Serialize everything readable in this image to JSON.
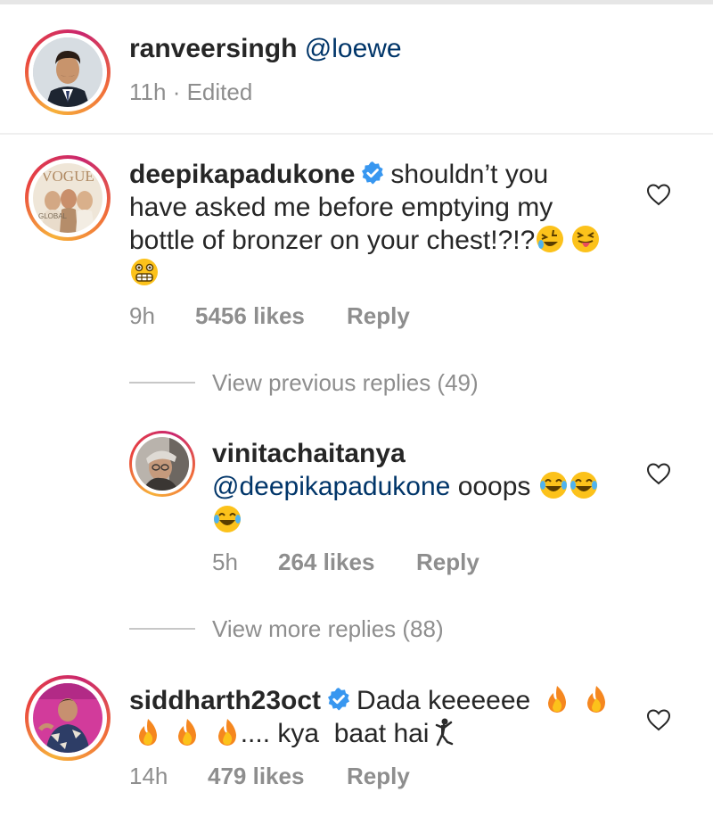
{
  "post": {
    "username": "ranveersingh",
    "mention": "@loewe",
    "time": "11h",
    "separator": "·",
    "edited": "Edited"
  },
  "comments": [
    {
      "username": "deepikapadukone",
      "verified": true,
      "line1": "shouldn’t you",
      "line2": "have asked me before emptying my",
      "line3": "bottle of bronzer on your chest!?!?",
      "time": "9h",
      "likes": "5456 likes",
      "reply": "Reply",
      "avatar_text": "VOGUE",
      "avatar_caption": "GLOBAL"
    },
    {
      "username": "vinitachaitanya",
      "mention": "@deepikapadukone",
      "text": "ooops",
      "time": "5h",
      "likes": "264 likes",
      "reply": "Reply"
    },
    {
      "username": "siddharth23oct",
      "verified": true,
      "line1": "Dada keeeeee",
      "line2": ".... kya  baat hai",
      "time": "14h",
      "likes": "479 likes",
      "reply": "Reply"
    }
  ],
  "view_previous": "View previous replies (49)",
  "view_more": "View more replies (88)",
  "colors": {
    "text": "#262626",
    "secondary": "#8e8e8e",
    "mention": "#003569",
    "verified": "#3897f0",
    "story_ring": [
      "#f7b13a",
      "#e9433f",
      "#c9266e"
    ]
  },
  "icons": [
    "verified-badge-icon",
    "heart-icon",
    "rolling-laughing-emoji",
    "squinting-tongue-emoji",
    "grimacing-emoji",
    "tears-of-joy-emoji",
    "fire-emoji",
    "dancing-man-emoji"
  ]
}
